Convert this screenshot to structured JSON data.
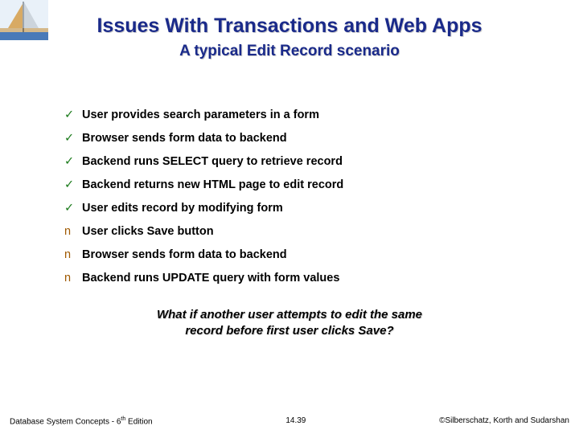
{
  "title": "Issues With Transactions and Web Apps",
  "subtitle": "A typical Edit Record scenario",
  "items": [
    {
      "bullet": "check",
      "text": "User provides search parameters in a form"
    },
    {
      "bullet": "check",
      "text": "Browser sends form data to backend"
    },
    {
      "bullet": "check",
      "text": "Backend runs SELECT query to retrieve record"
    },
    {
      "bullet": "check",
      "text": "Backend returns new HTML page to edit record"
    },
    {
      "bullet": "check",
      "text": "User edits record by modifying form"
    },
    {
      "bullet": "n",
      "text": "User clicks Save button"
    },
    {
      "bullet": "n",
      "text": "Browser sends form data to backend"
    },
    {
      "bullet": "n",
      "text": "Backend runs UPDATE query with form values"
    }
  ],
  "callout_line1": "What if another user attempts to edit the same",
  "callout_line2": "record before first user clicks Save?",
  "footer": {
    "left_prefix": "Database System Concepts - 6",
    "left_suffix": " Edition",
    "center": "14.39",
    "right": "©Silberschatz, Korth and Sudarshan"
  },
  "glyphs": {
    "check": "✓",
    "n": "n"
  }
}
